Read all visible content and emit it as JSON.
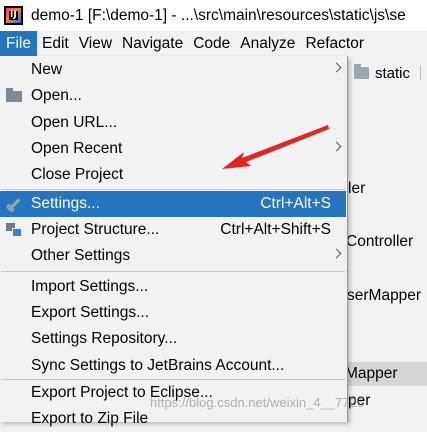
{
  "window": {
    "app_icon_letters": "IJ",
    "title": "demo-1 [F:\\demo-1] - ...\\src\\main\\resources\\static\\js\\se"
  },
  "menubar": {
    "items": [
      "File",
      "Edit",
      "View",
      "Navigate",
      "Code",
      "Analyze",
      "Refactor"
    ]
  },
  "background": {
    "breadcrumb": "static",
    "fragments": [
      "ler",
      "Controller",
      "serMapper",
      "Mapper",
      "per"
    ]
  },
  "file_menu": {
    "items": [
      {
        "label": "New",
        "shortcut": "",
        "submenu": true
      },
      {
        "label": "Open...",
        "shortcut": "",
        "submenu": false,
        "icon": "folder-open-icon"
      },
      {
        "label": "Open URL...",
        "shortcut": "",
        "submenu": false
      },
      {
        "label": "Open Recent",
        "shortcut": "",
        "submenu": true
      },
      {
        "label": "Close Project",
        "shortcut": "",
        "submenu": false
      },
      {
        "label": "Settings...",
        "shortcut": "Ctrl+Alt+S",
        "submenu": false,
        "icon": "wrench-icon",
        "selected": true
      },
      {
        "label": "Project Structure...",
        "shortcut": "Ctrl+Alt+Shift+S",
        "submenu": false,
        "icon": "project-structure-icon"
      },
      {
        "label": "Other Settings",
        "shortcut": "",
        "submenu": true
      },
      {
        "label": "Import Settings...",
        "shortcut": "",
        "submenu": false
      },
      {
        "label": "Export Settings...",
        "shortcut": "",
        "submenu": false
      },
      {
        "label": "Settings Repository...",
        "shortcut": "",
        "submenu": false
      },
      {
        "label": "Sync Settings to JetBrains Account...",
        "shortcut": "",
        "submenu": false
      },
      {
        "label": "Export Project to Eclipse...",
        "shortcut": "",
        "submenu": false
      },
      {
        "label": "Export to Zip File",
        "shortcut": "",
        "submenu": false
      }
    ]
  },
  "watermark": "https://blog.csdn.net/weixin_4__7726",
  "colors": {
    "selection": "#2675bf",
    "annotation_arrow": "#e8231f"
  }
}
